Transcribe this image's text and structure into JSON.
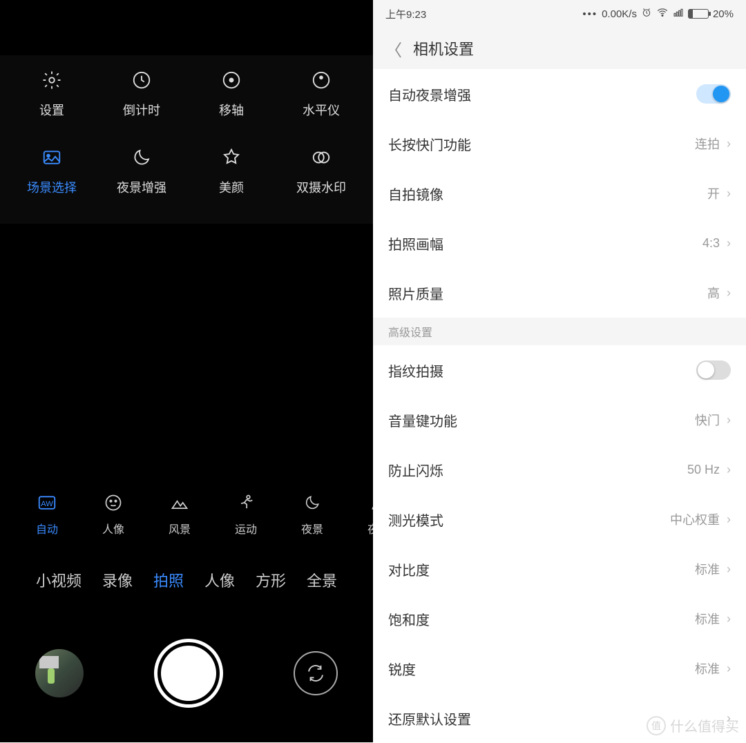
{
  "left": {
    "options": [
      {
        "name": "settings",
        "label": "设置",
        "icon": "gear"
      },
      {
        "name": "timer",
        "label": "倒计时",
        "icon": "clock"
      },
      {
        "name": "tiltshift",
        "label": "移轴",
        "icon": "target"
      },
      {
        "name": "level",
        "label": "水平仪",
        "icon": "level"
      },
      {
        "name": "scene",
        "label": "场景选择",
        "icon": "picture",
        "active": true
      },
      {
        "name": "night",
        "label": "夜景增强",
        "icon": "moon"
      },
      {
        "name": "beauty",
        "label": "美颜",
        "icon": "star"
      },
      {
        "name": "dualwm",
        "label": "双摄水印",
        "icon": "dualcircle"
      }
    ],
    "scenes": [
      {
        "name": "auto",
        "label": "自动",
        "icon": "aw",
        "active": true
      },
      {
        "name": "portrait",
        "label": "人像",
        "icon": "face"
      },
      {
        "name": "landscape",
        "label": "风景",
        "icon": "mountain"
      },
      {
        "name": "sport",
        "label": "运动",
        "icon": "runner"
      },
      {
        "name": "night",
        "label": "夜景",
        "icon": "moon"
      },
      {
        "name": "night2",
        "label": "夜景",
        "icon": "person"
      }
    ],
    "modes": [
      {
        "name": "shortvideo",
        "label": "小视频"
      },
      {
        "name": "video",
        "label": "录像"
      },
      {
        "name": "photo",
        "label": "拍照",
        "active": true
      },
      {
        "name": "portrait",
        "label": "人像"
      },
      {
        "name": "square",
        "label": "方形"
      },
      {
        "name": "pano",
        "label": "全景"
      }
    ]
  },
  "right": {
    "statusbar": {
      "time": "上午9:23",
      "speed": "0.00K/s",
      "battery_pct": "20%"
    },
    "title": "相机设置",
    "rows": [
      {
        "name": "auto-night",
        "label": "自动夜景增强",
        "type": "toggle",
        "on": true
      },
      {
        "name": "long-press",
        "label": "长按快门功能",
        "value": "连拍"
      },
      {
        "name": "selfie-mirror",
        "label": "自拍镜像",
        "value": "开"
      },
      {
        "name": "aspect",
        "label": "拍照画幅",
        "value": "4:3"
      },
      {
        "name": "quality",
        "label": "照片质量",
        "value": "高"
      }
    ],
    "section_label": "高级设置",
    "rows2": [
      {
        "name": "fingerprint",
        "label": "指纹拍摄",
        "type": "toggle",
        "on": false
      },
      {
        "name": "volume-key",
        "label": "音量键功能",
        "value": "快门"
      },
      {
        "name": "anti-flicker",
        "label": "防止闪烁",
        "value": "50 Hz"
      },
      {
        "name": "metering",
        "label": "测光模式",
        "value": "中心权重"
      },
      {
        "name": "contrast",
        "label": "对比度",
        "value": "标准"
      },
      {
        "name": "saturation",
        "label": "饱和度",
        "value": "标准"
      },
      {
        "name": "sharpness",
        "label": "锐度",
        "value": "标准"
      },
      {
        "name": "reset",
        "label": "还原默认设置"
      }
    ]
  },
  "watermark": "什么值得买"
}
